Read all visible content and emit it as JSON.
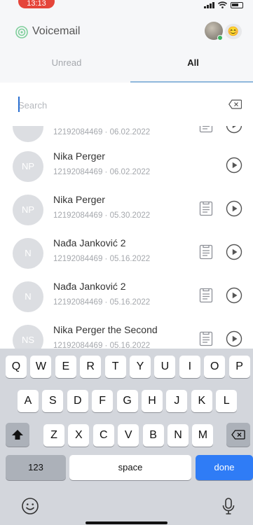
{
  "status_bar": {
    "time": "13:13"
  },
  "header": {
    "title": "Voicemail",
    "emoji": "😊"
  },
  "tabs": [
    {
      "label": "Unread",
      "active": false
    },
    {
      "label": "All",
      "active": true
    }
  ],
  "search": {
    "placeholder": "Search",
    "value": ""
  },
  "voicemails": [
    {
      "initials": "",
      "name": "",
      "meta": "12192084469 · 06.02.2022",
      "has_transcript": true
    },
    {
      "initials": "NP",
      "name": "Nika Perger",
      "meta": "12192084469 · 06.02.2022",
      "has_transcript": false
    },
    {
      "initials": "NP",
      "name": "Nika Perger",
      "meta": "12192084469 · 05.30.2022",
      "has_transcript": true
    },
    {
      "initials": "N",
      "name": "Nađa Janković 2",
      "meta": "12192084469 · 05.16.2022",
      "has_transcript": true
    },
    {
      "initials": "N",
      "name": "Nađa Janković 2",
      "meta": "12192084469 · 05.16.2022",
      "has_transcript": true
    },
    {
      "initials": "NS",
      "name": "Nika Perger the Second",
      "meta": "12192084469 · 05.16.2022",
      "has_transcript": true
    }
  ],
  "keyboard": {
    "row1": [
      "Q",
      "W",
      "E",
      "R",
      "T",
      "Y",
      "U",
      "I",
      "O",
      "P"
    ],
    "row2": [
      "A",
      "S",
      "D",
      "F",
      "G",
      "H",
      "J",
      "K",
      "L"
    ],
    "row3": [
      "Z",
      "X",
      "C",
      "V",
      "B",
      "N",
      "M"
    ],
    "numbers_label": "123",
    "space_label": "space",
    "done_label": "done"
  },
  "colors": {
    "accent": "#2f7cf6",
    "tab_underline": "#8fb8dc",
    "avatar_bg": "#dcdee2",
    "status_pill": "#e5453a"
  }
}
